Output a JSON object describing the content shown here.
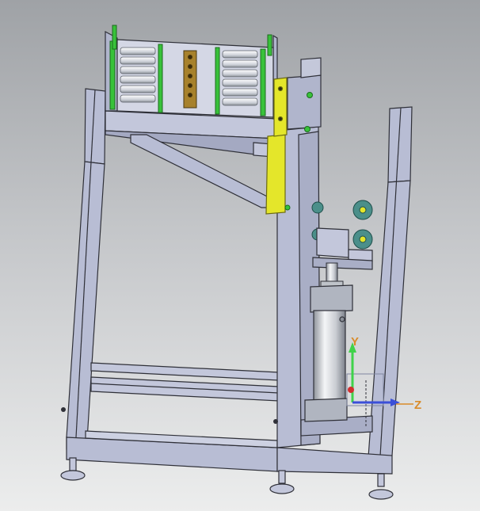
{
  "scene": {
    "background_top": "#9fa2a6",
    "background_bottom": "#eceded",
    "frame_color": "#b8bdd4",
    "frame_edge": "#2f3038",
    "accent_yellow": "#e4e62a",
    "accent_green": "#38c23a",
    "brass": "#a7812c",
    "gear_teal": "#4b8f8a",
    "cylinder_silver": "#d7dadf"
  },
  "triad": {
    "y_label": "Y",
    "z_label": "Z",
    "y_color": "#3fd24a",
    "z_color": "#3b4fd8",
    "x_color": "#d22f2f",
    "label_color": "#d98b2a"
  }
}
